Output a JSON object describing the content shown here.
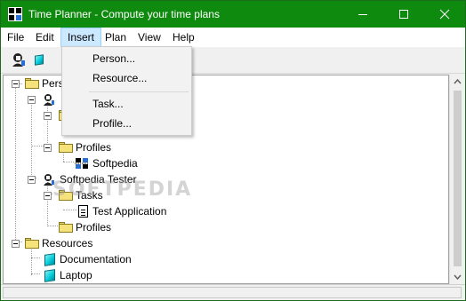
{
  "window": {
    "title": "Time Planner - Compute your time plans",
    "title_bar_color": "#0e8a0e"
  },
  "menubar": {
    "items": [
      {
        "label": "File"
      },
      {
        "label": "Edit"
      },
      {
        "label": "Insert",
        "active": true
      },
      {
        "label": "Plan"
      },
      {
        "label": "View"
      },
      {
        "label": "Help"
      }
    ]
  },
  "insert_menu": {
    "items": [
      {
        "label": "Person..."
      },
      {
        "label": "Resource..."
      },
      {
        "label": "Task..."
      },
      {
        "label": "Profile..."
      }
    ]
  },
  "toolbar": {
    "buttons": [
      {
        "icon": "person-icon"
      },
      {
        "icon": "resource-cube-icon"
      }
    ]
  },
  "tree": {
    "persons_label": "Pers",
    "person1_profiles_label": "Profiles",
    "person1_profile_item": "Softpedia",
    "person2_label": "Softpedia Tester",
    "person2_tasks_label": "Tasks",
    "person2_task_item": "Test Application",
    "person2_profiles_label": "Profiles",
    "resources_label": "Resources",
    "resource_items": [
      "Documentation",
      "Laptop"
    ]
  },
  "watermark": "SOFTPEDIA"
}
